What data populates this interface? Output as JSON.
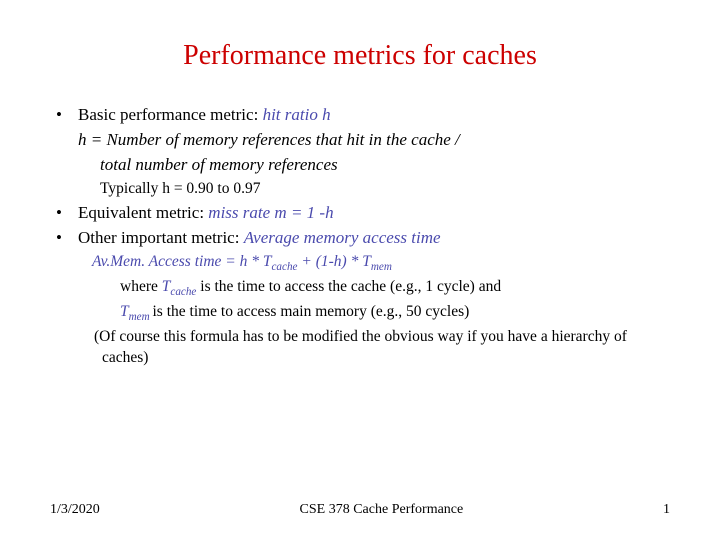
{
  "title": "Performance metrics for caches",
  "bullet1": {
    "label": "Basic performance metric: ",
    "term": "hit ratio h"
  },
  "formula1_line1": "h = Number of memory references that hit in the cache /",
  "formula1_line2": "total number of memory references",
  "typical": "Typically h = 0.90 to 0.97",
  "bullet2": {
    "label": "Equivalent metric: ",
    "term": "miss rate m = 1 -h"
  },
  "bullet3": {
    "label": "Other important metric: ",
    "term": "Average memory access time"
  },
  "formula2": {
    "prefix": "Av.Mem. Access time = h * T",
    "sub1": "cache",
    "mid": " + (1-h) * T",
    "sub2": "mem"
  },
  "where1": {
    "prefix": "where ",
    "tc": "T",
    "tcsub": "cache",
    "rest": "  is the time to access the cache (e.g., 1 cycle) and"
  },
  "where2": {
    "tm": "T",
    "tmsub": "mem ",
    "rest": "is the time to access  main memory (e.g., 50 cycles)"
  },
  "note": "(Of course this formula has to be modified the obvious way if you have a hierarchy of caches)",
  "footer": {
    "date": "1/3/2020",
    "course": "CSE 378 Cache Performance",
    "page": "1"
  }
}
